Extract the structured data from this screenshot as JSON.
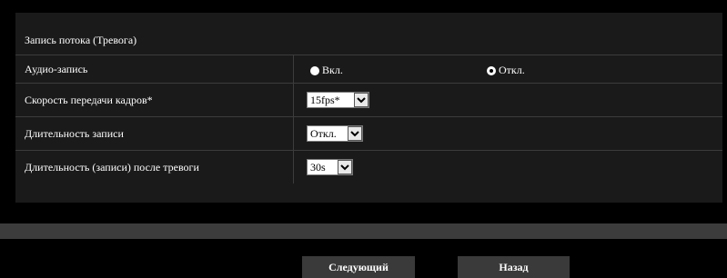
{
  "section": {
    "title": "Запись потока (Тревога)"
  },
  "audio_recording": {
    "label": "Аудио-запись",
    "options": [
      "Вкл.",
      "Откл."
    ],
    "selected": "Откл."
  },
  "frame_rate": {
    "label": "Скорость передачи кадров*",
    "value": "15fps*"
  },
  "record_duration": {
    "label": "Длительность записи",
    "value": "Откл."
  },
  "post_alarm_duration": {
    "label": "Длительность (записи) после тревоги",
    "value": "30s"
  },
  "buttons": {
    "next": "Следующий",
    "back": "Назад"
  },
  "icons": {
    "dropdown": "chevron-down-icon",
    "radio_unselected": "radio-unselected-icon",
    "radio_selected": "radio-selected-icon"
  }
}
